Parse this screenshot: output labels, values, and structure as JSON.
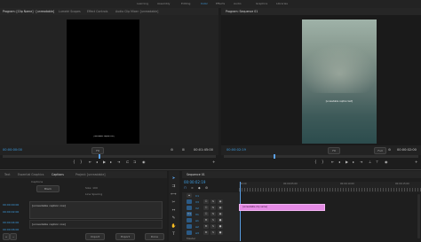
{
  "workspace_tabs": [
    "Learning",
    "Assembly",
    "Editing",
    "Color",
    "Effects",
    "Audio",
    "Graphics",
    "Libraries"
  ],
  "active_workspace": "Color",
  "source_tabs": [
    "Program: [Clip Name] · [unreadable]",
    "Lumetri Scopes",
    "Effect Controls",
    "Audio Clip Mixer: [unreadable]"
  ],
  "program_tab": "Program: Sequence 01",
  "source_monitor": {
    "timecode_left": "00:00:00:00",
    "fit": "Fit",
    "timecode_right": "00:01:45:00",
    "caption_text": "[unreadable caption text]"
  },
  "program_monitor": {
    "timecode_left": "00:00:02:19",
    "fit": "Fit",
    "full": "Full",
    "timecode_right": "00:00:02:00",
    "caption_text": "[unreadable caption text]"
  },
  "bottom_left_tabs": [
    "Text",
    "Essential Graphics",
    "Captions",
    "Project: [unreadable]"
  ],
  "captions_panel": {
    "stream_label": "Captions",
    "font_value": "Black",
    "font_size": "Size: 100",
    "line_spacing": "Line Spacing",
    "caption_rows": [
      "[unreadable caption row]",
      "[unreadable caption row]"
    ],
    "timecodes": [
      "00:00:00:00",
      "00:00:02:00",
      "00:00:04:00",
      "00:00:06:00"
    ],
    "bottom_buttons": [
      "+",
      "−",
      "Import",
      "Export",
      "Done"
    ]
  },
  "timeline": {
    "tab": "Sequence 01",
    "timecode": "00:00:02:19",
    "ruler_labels": [
      "00:00",
      "00:00:05:00",
      "00:00:10:00",
      "00:00:15:00"
    ],
    "clip_label": "[unreadable clip name]",
    "track_labels": [
      "C1",
      "V3",
      "V2",
      "V1",
      "A1",
      "A2",
      "A3",
      "Master"
    ]
  },
  "colors": {
    "accent": "#3e9fe4",
    "clip_pink": "#e58be5",
    "playhead": "#5aa0e6",
    "program_bg_top": "#9fb2a8",
    "program_bg_bottom": "#2c4c4d"
  }
}
